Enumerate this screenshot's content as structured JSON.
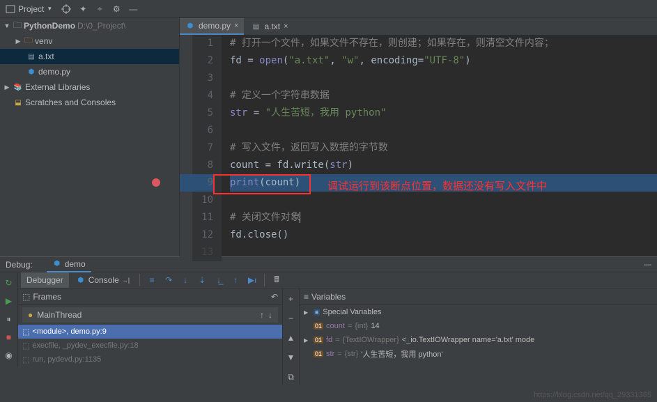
{
  "toolbar": {
    "project_label": "Project"
  },
  "sidebar": {
    "root": "PythonDemo",
    "root_path": "D:\\0_Project\\",
    "items": [
      {
        "name": "venv",
        "type": "folder"
      },
      {
        "name": "a.txt",
        "type": "file"
      },
      {
        "name": "demo.py",
        "type": "pyfile"
      }
    ],
    "external_libs": "External Libraries",
    "scratches": "Scratches and Consoles"
  },
  "tabs": [
    {
      "name": "demo.py",
      "icon": "python",
      "active": true
    },
    {
      "name": "a.txt",
      "icon": "text",
      "active": false
    }
  ],
  "code": {
    "lines": [
      {
        "n": 1,
        "type": "comment",
        "text": "# 打开一个文件，如果文件不存在，则创建；如果存在，则清空文件内容；"
      },
      {
        "n": 2,
        "type": "code",
        "parts": [
          "fd",
          " = ",
          "open",
          "(",
          "\"a.txt\"",
          ", ",
          "\"w\"",
          ", encoding=",
          "\"UTF-8\"",
          ")"
        ]
      },
      {
        "n": 3,
        "type": "blank"
      },
      {
        "n": 4,
        "type": "comment",
        "text": "# 定义一个字符串数据"
      },
      {
        "n": 5,
        "type": "code",
        "parts": [
          "str",
          " = ",
          "\"人生苦短，我用 python\""
        ]
      },
      {
        "n": 6,
        "type": "blank"
      },
      {
        "n": 7,
        "type": "comment",
        "text": "# 写入文件，返回写入数据的字节数"
      },
      {
        "n": 8,
        "type": "code",
        "parts": [
          "count = fd.write(str)"
        ]
      },
      {
        "n": 9,
        "type": "exec",
        "parts": [
          "print",
          "(count)"
        ]
      },
      {
        "n": 10,
        "type": "blank"
      },
      {
        "n": 11,
        "type": "comment",
        "text": "# 关闭文件对象"
      },
      {
        "n": 12,
        "type": "code",
        "parts": [
          "fd.close()"
        ]
      }
    ],
    "annotation": "调试运行到该断点位置，数据还没有写入文件中"
  },
  "debug": {
    "label": "Debug:",
    "config_name": "demo",
    "tabs": {
      "debugger": "Debugger",
      "console": "Console"
    },
    "frames": {
      "title": "Frames",
      "thread": "MainThread",
      "items": [
        {
          "text": "<module>, demo.py:9",
          "active": true
        },
        {
          "text": "execfile, _pydev_execfile.py:18",
          "active": false
        },
        {
          "text": "run, pydevd.py:1135",
          "active": false
        }
      ]
    },
    "variables": {
      "title": "Variables",
      "special": "Special Variables",
      "items": [
        {
          "name": "count",
          "type": "{int}",
          "value": "14",
          "badge": "01"
        },
        {
          "name": "fd",
          "type": "{TextIOWrapper}",
          "value": "<_io.TextIOWrapper name='a.txt' mode",
          "badge": "01"
        },
        {
          "name": "str",
          "type": "{str}",
          "value": "'人生苦短，我用 python'",
          "badge": "01"
        }
      ]
    }
  },
  "watermark": "https://blog.csdn.net/qq_29331365"
}
